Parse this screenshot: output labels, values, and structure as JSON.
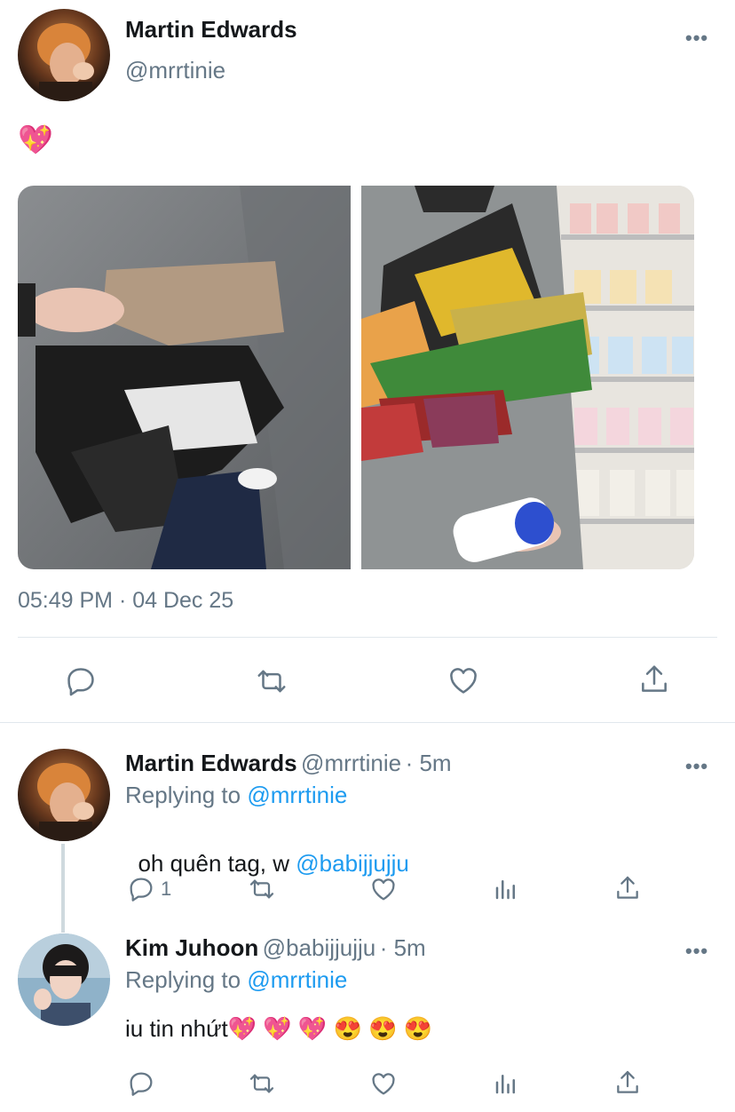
{
  "main_tweet": {
    "author_name": "Martin Edwards",
    "author_handle": "@mrrtinie",
    "text": "💖",
    "timestamp": "05:49 PM · 04 Dec 25",
    "more_label": "•••"
  },
  "replies": [
    {
      "author_name": "Martin Edwards",
      "author_handle": "@mrrtinie",
      "time": "· 5m",
      "replying_prefix": "Replying to ",
      "replying_to": "@mrrtinie",
      "text_prefix": "oh quên tag, w ",
      "text_mention": "@babijjujju",
      "reply_count": "1",
      "more_label": "•••"
    },
    {
      "author_name": "Kim Juhoon",
      "author_handle": "@babijjujju",
      "time": "· 5m",
      "replying_prefix": "Replying to ",
      "replying_to": "@mrrtinie",
      "text": "iu tin nhứt💖 💖 💖 😍 😍 😍",
      "more_label": "•••"
    }
  ],
  "icons": [
    "reply-icon",
    "retweet-icon",
    "like-icon",
    "share-icon",
    "analytics-icon",
    "more-icon"
  ],
  "colors": {
    "link": "#1d9bf0",
    "muted": "#657786",
    "divider": "#e1e8ed"
  }
}
